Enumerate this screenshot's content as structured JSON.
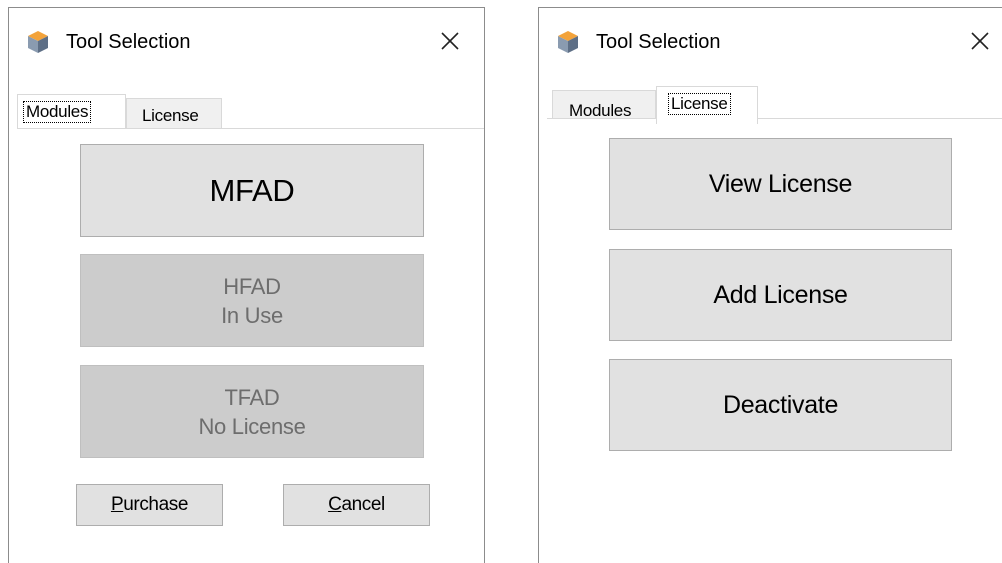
{
  "left_window": {
    "title": "Tool Selection",
    "tabs": [
      {
        "label": "Modules",
        "active": true
      },
      {
        "label": "License",
        "active": false
      }
    ],
    "modules": {
      "mfad": {
        "label": "MFAD",
        "enabled": true
      },
      "hfad": {
        "label": "HFAD",
        "status": "In Use",
        "enabled": false
      },
      "tfad": {
        "label": "TFAD",
        "status": "No License",
        "enabled": false
      }
    },
    "purchase": {
      "accel": "P",
      "rest": "urchase"
    },
    "cancel": {
      "accel": "C",
      "rest": "ancel"
    }
  },
  "right_window": {
    "title": "Tool Selection",
    "tabs": [
      {
        "label": "Modules",
        "active": false
      },
      {
        "label": "License",
        "active": true
      }
    ],
    "buttons": {
      "view": "View License",
      "add": "Add License",
      "deactivate": "Deactivate"
    }
  },
  "icons": {
    "app": "cube-icon",
    "close": "close-icon"
  },
  "colors": {
    "button_face": "#e1e1e1",
    "button_disabled": "#cccccc",
    "disabled_text": "#6d6d6d",
    "border": "#adadad"
  }
}
